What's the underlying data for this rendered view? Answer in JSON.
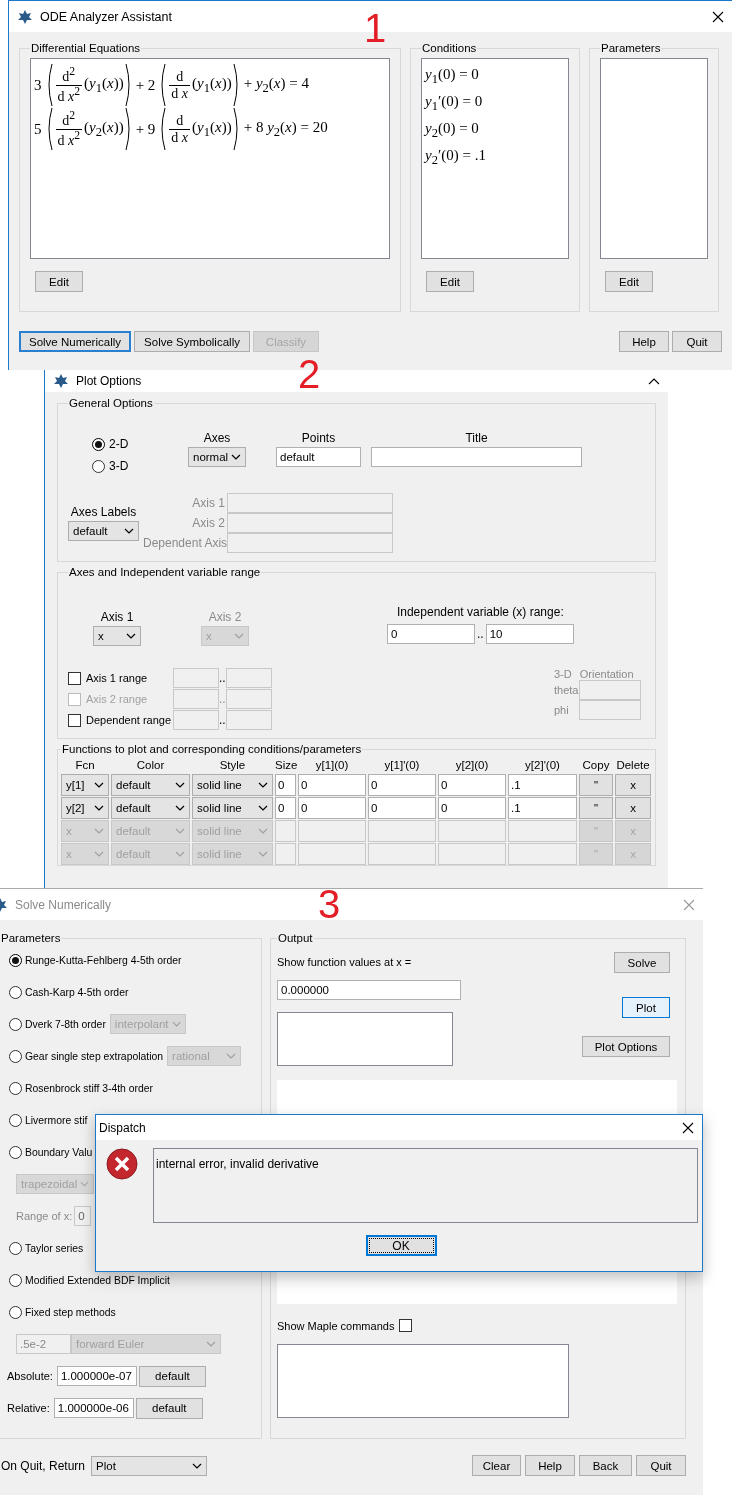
{
  "ode_window": {
    "title": "ODE Analyzer Assistant",
    "annotation": "1",
    "equations_group": {
      "label": "Differential Equations",
      "edit_button": "Edit",
      "equations": [
        {
          "parts": [
            {
              "kind": "text",
              "text": "3"
            },
            {
              "kind": "group",
              "parts": [
                {
                  "kind": "frac",
                  "num": "d$^{2}$",
                  "den": "d *x*$^{2}$"
                },
                {
                  "kind": "text",
                  "text": "(*y*$_{1}$(*x*))"
                }
              ]
            },
            {
              "kind": "text",
              "text": "+ 2"
            },
            {
              "kind": "group",
              "parts": [
                {
                  "kind": "frac",
                  "num": "d",
                  "den": "d *x*"
                },
                {
                  "kind": "text",
                  "text": "(*y*$_{1}$(*x*))"
                }
              ]
            },
            {
              "kind": "text",
              "text": "+ *y*$_{2}$(*x*) = 4"
            }
          ]
        },
        {
          "parts": [
            {
              "kind": "text",
              "text": "5"
            },
            {
              "kind": "group",
              "parts": [
                {
                  "kind": "frac",
                  "num": "d$^{2}$",
                  "den": "d *x*$^{2}$"
                },
                {
                  "kind": "text",
                  "text": "(*y*$_{2}$(*x*))"
                }
              ]
            },
            {
              "kind": "text",
              "text": "+ 9"
            },
            {
              "kind": "group",
              "parts": [
                {
                  "kind": "frac",
                  "num": "d",
                  "den": "d *x*"
                },
                {
                  "kind": "text",
                  "text": "(*y*$_{1}$(*x*))"
                }
              ]
            },
            {
              "kind": "text",
              "text": "+ 8 *y*$_{2}$(*x*) = 20"
            }
          ]
        }
      ]
    },
    "conditions_group": {
      "label": "Conditions",
      "edit_button": "Edit",
      "conditions": [
        "*y*$_{1}$(0) = 0",
        "*y*$_{1}$′(0) = 0",
        "*y*$_{2}$(0) = 0",
        "*y*$_{2}$′(0) = .1"
      ]
    },
    "parameters_group": {
      "label": "Parameters",
      "edit_button": "Edit"
    },
    "buttons": [
      {
        "label": "Solve Numerically",
        "focused": true,
        "disabled": false
      },
      {
        "label": "Solve Symbolically",
        "focused": false,
        "disabled": false
      },
      {
        "label": "Classify",
        "focused": false,
        "disabled": true
      }
    ],
    "right_buttons": [
      "Help",
      "Quit"
    ]
  },
  "plot_options_window": {
    "title": "Plot Options",
    "annotation": "2",
    "general": {
      "label": "General Options",
      "dims": [
        {
          "label": "2-D",
          "selected": true
        },
        {
          "label": "3-D",
          "selected": false
        }
      ],
      "axes": {
        "label": "Axes",
        "value": "normal"
      },
      "points": {
        "label": "Points",
        "value": "default"
      },
      "title_field": {
        "label": "Title"
      },
      "axes_labels": {
        "label": "Axes Labels",
        "value": "default"
      },
      "axis_label_fields": [
        "Axis 1",
        "Axis 2",
        "Dependent Axis"
      ]
    },
    "range": {
      "label": "Axes and Independent variable range",
      "axes": [
        {
          "label": "Axis 1",
          "value": "x",
          "disabled": false
        },
        {
          "label": "Axis 2",
          "value": "x",
          "disabled": true
        }
      ],
      "independent": {
        "label": "Independent variable (x) range:",
        "from": "0",
        "sep": "..",
        "to": "10"
      },
      "ranges": [
        {
          "label": "Axis 1 range",
          "checked": false,
          "disabled": false,
          "sep": ".."
        },
        {
          "label": "Axis 2 range",
          "checked": false,
          "disabled": true,
          "sep": ".."
        },
        {
          "label": "Dependent range",
          "checked": false,
          "disabled": false,
          "sep": ".."
        }
      ],
      "orientation": {
        "label_1": "3-D",
        "label_2": "Orientation",
        "angles": [
          "theta",
          "phi"
        ]
      }
    },
    "functions": {
      "label": "Functions to plot and corresponding conditions/parameters",
      "columns": [
        "Fcn",
        "Color",
        "Style",
        "Size",
        "y[1](0)",
        "y[1]'(0)",
        "y[2](0)",
        "y[2]'(0)",
        "Copy",
        "Delete"
      ],
      "rows": [
        {
          "disabled": false,
          "fcn": "y[1]",
          "line_color": "default",
          "style": "solid line",
          "size": "0",
          "values": [
            "0",
            "0",
            "0",
            ".1"
          ],
          "copy": "\"",
          "delete": "x"
        },
        {
          "disabled": false,
          "fcn": "y[2]",
          "line_color": "default",
          "style": "solid line",
          "size": "0",
          "values": [
            "0",
            "0",
            "0",
            ".1"
          ],
          "copy": "\"",
          "delete": "x"
        },
        {
          "disabled": true,
          "fcn": "x",
          "line_color": "default",
          "style": "solid line",
          "copy": "\"",
          "delete": "x"
        },
        {
          "disabled": true,
          "fcn": "x",
          "line_color": "default",
          "style": "solid line",
          "copy": "\"",
          "delete": "x"
        }
      ]
    }
  },
  "solve_window": {
    "title": "Solve Numerically",
    "annotation": "3",
    "parameters": {
      "label": "Parameters",
      "items": [
        {
          "kind": "method",
          "label": "Runge-Kutta-Fehlberg 4-5th order",
          "selected": true
        },
        {
          "kind": "method",
          "label": "Cash-Karp 4-5th order",
          "selected": false
        },
        {
          "kind": "method",
          "label": "Dverk 7-8th order",
          "selected": false,
          "option": "interpolant"
        },
        {
          "kind": "method",
          "label": "Gear single step extrapolation",
          "selected": false,
          "option": "rational"
        },
        {
          "kind": "method",
          "label": "Rosenbrock stiff 3-4th order",
          "selected": false
        },
        {
          "kind": "method",
          "label": "Livermore stif",
          "selected": false
        },
        {
          "kind": "method",
          "label": "Boundary Valu",
          "selected": false
        },
        {
          "kind": "bvp_method",
          "value": "trapezoidal"
        },
        {
          "kind": "bvp_range",
          "label": "Range of x:",
          "value": "0"
        },
        {
          "kind": "method",
          "label": "Taylor series",
          "selected": false
        },
        {
          "kind": "method",
          "label": "Modified Extended BDF Implicit",
          "selected": false
        },
        {
          "kind": "method",
          "label": "Fixed step methods",
          "selected": false
        },
        {
          "kind": "fixed",
          "step": ".5e-2",
          "value": "forward Euler"
        },
        {
          "kind": "tolerance",
          "label": "Absolute:",
          "value": "1.000000e-07",
          "button": "default"
        },
        {
          "kind": "tolerance",
          "label": "Relative:",
          "value": "1.000000e-06",
          "button": "default"
        }
      ]
    },
    "output": {
      "label": "Output",
      "show_label": "Show function values at x =",
      "x_value": "0.000000",
      "buttons": [
        {
          "label": "Solve",
          "focused": false
        },
        {
          "label": "Plot",
          "focused": true
        },
        {
          "label": "Plot Options",
          "focused": false
        }
      ],
      "maple": {
        "label": "Show Maple commands",
        "checked": false
      }
    },
    "return": {
      "label": "On Quit, Return",
      "value": "Plot"
    },
    "buttons": [
      "Clear",
      "Help",
      "Back",
      "Quit"
    ]
  },
  "dispatch_dialog": {
    "title": "Dispatch",
    "message": "internal error, invalid derivative",
    "ok_button": {
      "label": "OK",
      "focused": true
    }
  }
}
